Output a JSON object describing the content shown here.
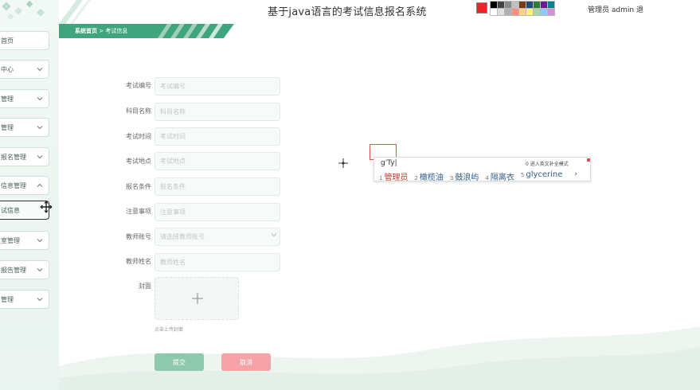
{
  "header": {
    "system_title": "基于java语言的考试信息报名系统",
    "font_glyph": "A",
    "font_size": "12",
    "admin_label": "管理员 admin 退",
    "current_color": "#e8262b",
    "palette": [
      "#000000",
      "#444444",
      "#888888",
      "#c0c0c0",
      "#7a3b12",
      "#1f4e79",
      "#2e7d32",
      "#6a1b9a",
      "#00838f",
      "#ffffff",
      "#dddddd",
      "#b0b0b0",
      "#ff8a80",
      "#ffd180",
      "#fff176",
      "#a5d6a7",
      "#90caf9",
      "#ce93d8"
    ]
  },
  "breadcrumb": {
    "home": "系统首页",
    "separator": ">",
    "current": "考试信息"
  },
  "sidebar": {
    "items": [
      {
        "label": "首页",
        "expanded": false
      },
      {
        "label": "中心",
        "expanded": false
      },
      {
        "label": "管理",
        "expanded": false
      },
      {
        "label": "管理",
        "expanded": false
      },
      {
        "label": "报名管理",
        "expanded": false
      },
      {
        "label": "信息管理",
        "expanded": true
      },
      {
        "label": "试信息",
        "expanded": false
      },
      {
        "label": "室管理",
        "expanded": false
      },
      {
        "label": "报告管理",
        "expanded": false
      },
      {
        "label": "管理",
        "expanded": false
      }
    ]
  },
  "form": {
    "fields": [
      {
        "label": "考试编号",
        "placeholder": "考试编号"
      },
      {
        "label": "科目名称",
        "placeholder": "科目名称"
      },
      {
        "label": "考试时间",
        "placeholder": "考试时间"
      },
      {
        "label": "考试地点",
        "placeholder": "考试地点"
      },
      {
        "label": "报名条件",
        "placeholder": "报名条件"
      },
      {
        "label": "注意事项",
        "placeholder": "注意事项"
      },
      {
        "label": "教师账号",
        "placeholder": "请选择教师账号"
      },
      {
        "label": "教师姓名",
        "placeholder": "教师姓名"
      }
    ],
    "cover_label": "封面",
    "upload_hint": "点击上传封面",
    "submit_label": "提交",
    "cancel_label": "取消"
  },
  "ime": {
    "code": "g'Ty|",
    "hint": "0 进入英文补全模式",
    "candidates": [
      {
        "n": "1",
        "text": "管理员"
      },
      {
        "n": "2",
        "text": "橄榄油"
      },
      {
        "n": "3",
        "text": "鼓浪屿"
      },
      {
        "n": "4",
        "text": "隔离衣"
      },
      {
        "n": "5",
        "text": "glycerine"
      }
    ],
    "next": "›"
  }
}
